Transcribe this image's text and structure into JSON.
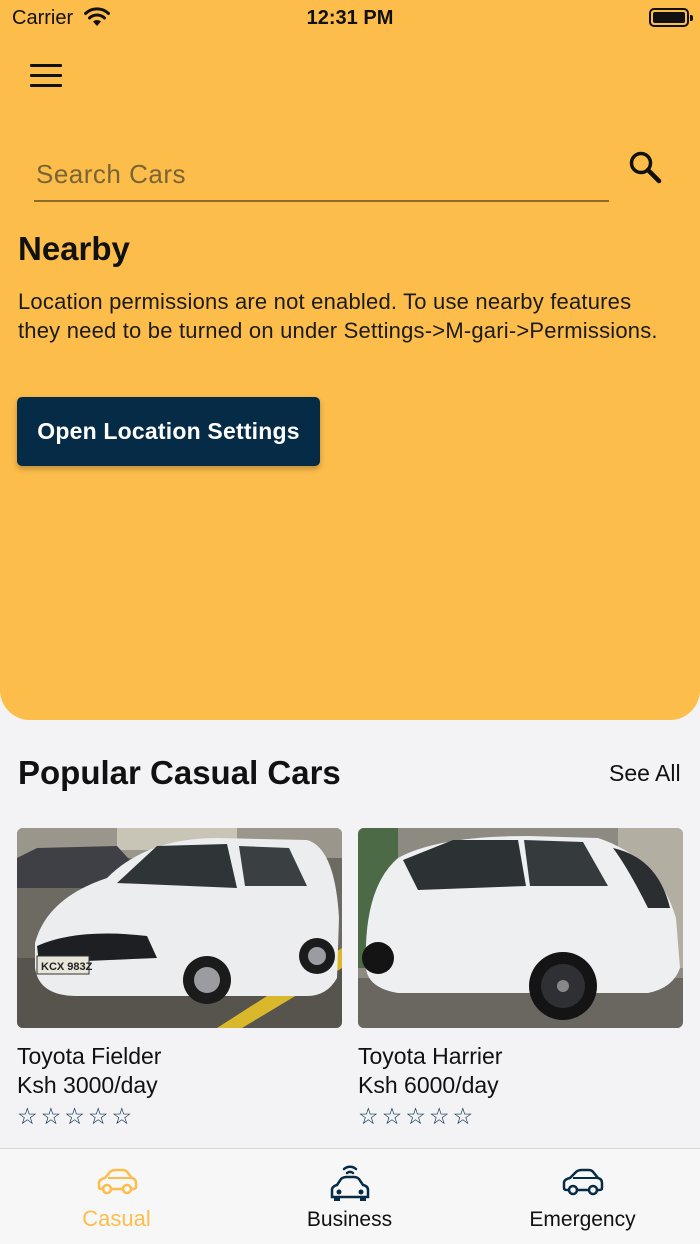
{
  "status_bar": {
    "carrier": "Carrier",
    "time": "12:31 PM"
  },
  "search": {
    "placeholder": "Search Cars",
    "value": ""
  },
  "nearby": {
    "title": "Nearby",
    "message": "Location permissions are not enabled. To use nearby features they need to be turned on under Settings->M-gari->Permissions.",
    "button_label": "Open Location Settings"
  },
  "popular": {
    "title": "Popular Casual Cars",
    "see_all": "See All",
    "cars": [
      {
        "name": "Toyota Fielder",
        "price": "Ksh 3000/day",
        "rating": 0,
        "plate": "KCX 983Z"
      },
      {
        "name": "Toyota Harrier",
        "price": "Ksh 6000/day",
        "rating": 0
      }
    ]
  },
  "tabs": [
    {
      "label": "Casual",
      "icon": "car-icon",
      "active": true
    },
    {
      "label": "Business",
      "icon": "connected-car-icon",
      "active": false
    },
    {
      "label": "Emergency",
      "icon": "emergency-car-icon",
      "active": false
    }
  ],
  "colors": {
    "accent": "#fcbd4b",
    "primary": "#062b46",
    "background": "#f3f3f5"
  }
}
